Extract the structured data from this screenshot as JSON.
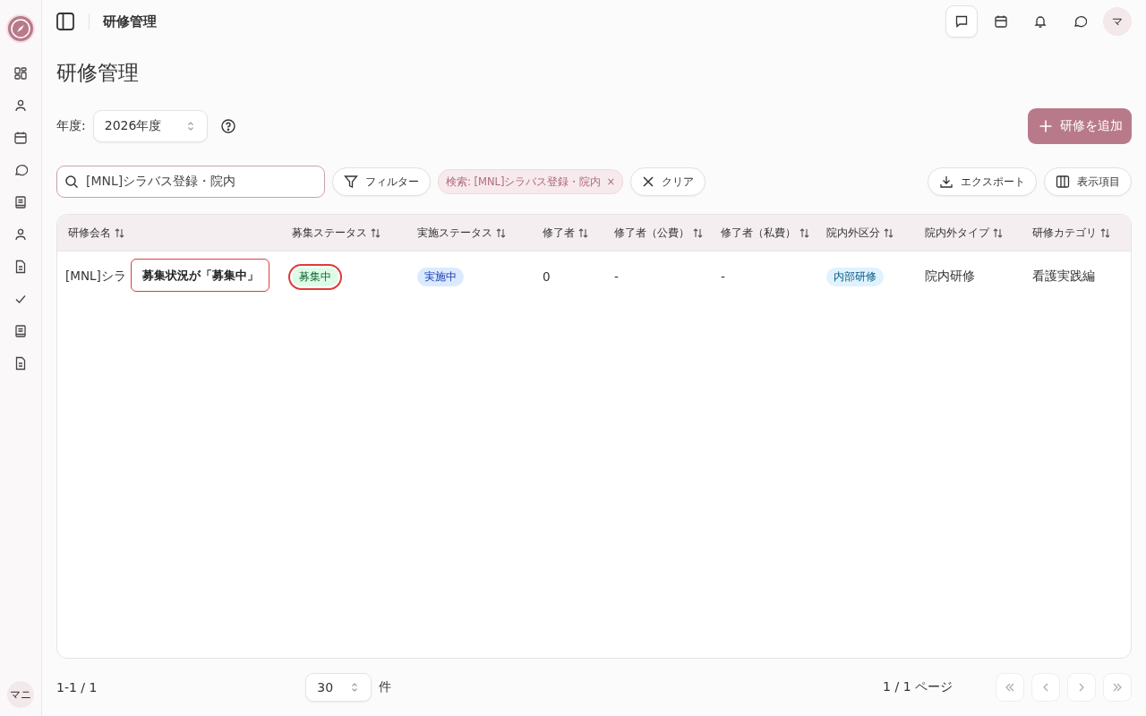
{
  "header": {
    "title": "研修管理",
    "avatar": "マ"
  },
  "page": {
    "title": "研修管理"
  },
  "year": {
    "label": "年度:",
    "value": "2026年度"
  },
  "add_button": "研修を追加",
  "search": {
    "value": "[MNL]シラバス登録・院内"
  },
  "filter_button": "フィルター",
  "chips": [
    {
      "label": "検索: [MNL]シラバス登録・院内",
      "close": "×"
    }
  ],
  "clear_button": "クリア",
  "export_button": "エクスポート",
  "columns_button": "表示項目",
  "table": {
    "columns": [
      "研修会名",
      "募集ステータス",
      "実施ステータス",
      "修了者",
      "修了者（公費）",
      "修了者（私費）",
      "院内外区分",
      "院内外タイプ",
      "研修カテゴリ"
    ],
    "rows": [
      {
        "cells": [
          {
            "kind": "text",
            "text": "[MNL]シラ"
          },
          {
            "kind": "badge",
            "text": "募集中",
            "color": "#dcfce7",
            "highlighted": true
          },
          {
            "kind": "badge",
            "text": "実施中",
            "color": "#dbeafe",
            "highlighted": false
          },
          {
            "kind": "text",
            "text": "0"
          },
          {
            "kind": "text",
            "text": "-"
          },
          {
            "kind": "text",
            "text": "-"
          },
          {
            "kind": "badge",
            "text": "内部研修",
            "color": "#e0f2fe",
            "highlighted": false
          },
          {
            "kind": "text",
            "text": "院内研修"
          },
          {
            "kind": "text",
            "text": "看護実践編"
          }
        ]
      }
    ]
  },
  "tooltip": "募集状況が「募集中」",
  "footer": {
    "range": "1-1 / 1",
    "page_size": "30",
    "unit": "件",
    "page_info": "1 / 1 ページ"
  },
  "user": {
    "initials": "マニ"
  }
}
